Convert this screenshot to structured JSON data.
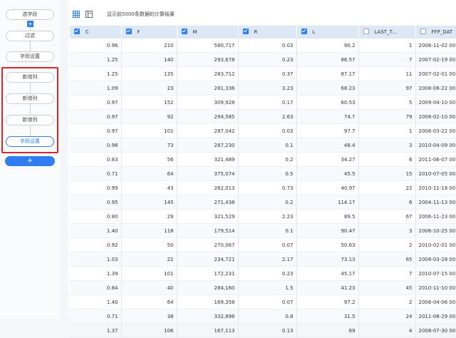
{
  "steps": {
    "select_field": "选字段",
    "filter": "过滤",
    "field_settings": "字段设置",
    "new_col_1": "新增列",
    "new_col_2": "新增列",
    "new_col_3": "新增列",
    "field_settings_active": "字段设置",
    "add_symbol": "+",
    "plus_small": "+"
  },
  "toolbar": {
    "info": "显示前5000条数据的计算结果",
    "icons": [
      "table-view-icon",
      "panel-view-icon"
    ]
  },
  "colors": {
    "accent": "#2f7df1",
    "header_bg": "#dde8f7",
    "highlight_box": "#d9262c"
  },
  "table": {
    "columns": [
      {
        "label": "C",
        "checked": true
      },
      {
        "label": "F",
        "checked": true
      },
      {
        "label": "M",
        "checked": true
      },
      {
        "label": "R",
        "checked": true
      },
      {
        "label": "L",
        "checked": true
      },
      {
        "label": "LAST_T...",
        "checked": false
      },
      {
        "label": "FFP_DAT",
        "checked": false
      }
    ],
    "rows": [
      [
        "0.96",
        "210",
        "580,717",
        "0.03",
        "90.2",
        "1",
        "2006-11-02 00:0"
      ],
      [
        "1.25",
        "140",
        "293,678",
        "0.23",
        "86.57",
        "7",
        "2007-02-19 00:0"
      ],
      [
        "1.25",
        "135",
        "283,712",
        "0.37",
        "87.17",
        "11",
        "2007-02-01 00:0"
      ],
      [
        "1.09",
        "23",
        "281,336",
        "3.23",
        "68.23",
        "97",
        "2008-08-22 00:0"
      ],
      [
        "0.97",
        "152",
        "309,928",
        "0.17",
        "60.53",
        "5",
        "2009-04-10 00:0"
      ],
      [
        "0.97",
        "92",
        "294,585",
        "2.63",
        "74.7",
        "79",
        "2008-02-10 00:0"
      ],
      [
        "0.97",
        "101",
        "287,042",
        "0.03",
        "97.7",
        "1",
        "2006-03-22 00:0"
      ],
      [
        "0.96",
        "73",
        "287,230",
        "0.1",
        "48.4",
        "3",
        "2010-04-09 00:0"
      ],
      [
        "0.83",
        "56",
        "321,489",
        "0.2",
        "34.27",
        "6",
        "2011-06-07 00:0"
      ],
      [
        "0.71",
        "64",
        "375,074",
        "0.5",
        "45.5",
        "15",
        "2010-07-05 00:0"
      ],
      [
        "0.99",
        "43",
        "262,013",
        "0.73",
        "40.97",
        "22",
        "2010-11-18 00:0"
      ],
      [
        "0.95",
        "145",
        "271,438",
        "0.2",
        "114.17",
        "6",
        "2004-11-13 00:0"
      ],
      [
        "0.80",
        "29",
        "321,529",
        "2.23",
        "89.5",
        "67",
        "2006-11-23 00:0"
      ],
      [
        "1.40",
        "118",
        "179,514",
        "0.1",
        "90.47",
        "3",
        "2006-10-25 00:0"
      ],
      [
        "0.92",
        "50",
        "270,067",
        "0.07",
        "50.63",
        "2",
        "2010-02-01 00:0"
      ],
      [
        "1.03",
        "22",
        "234,721",
        "2.17",
        "73.13",
        "65",
        "2008-03-28 00:0"
      ],
      [
        "1.39",
        "101",
        "172,231",
        "0.23",
        "45.17",
        "7",
        "2010-07-15 00:0"
      ],
      [
        "0.84",
        "40",
        "284,160",
        "1.5",
        "41.23",
        "45",
        "2010-11-10 00:0"
      ],
      [
        "1.40",
        "64",
        "169,358",
        "0.07",
        "97.2",
        "2",
        "2006-04-06 00:0"
      ],
      [
        "0.71",
        "38",
        "332,896",
        "0.8",
        "31.5",
        "24",
        "2011-08-29 00:0"
      ],
      [
        "1.37",
        "106",
        "167,113",
        "0.13",
        "69",
        "4",
        "2008-07-30 00:0"
      ]
    ]
  }
}
